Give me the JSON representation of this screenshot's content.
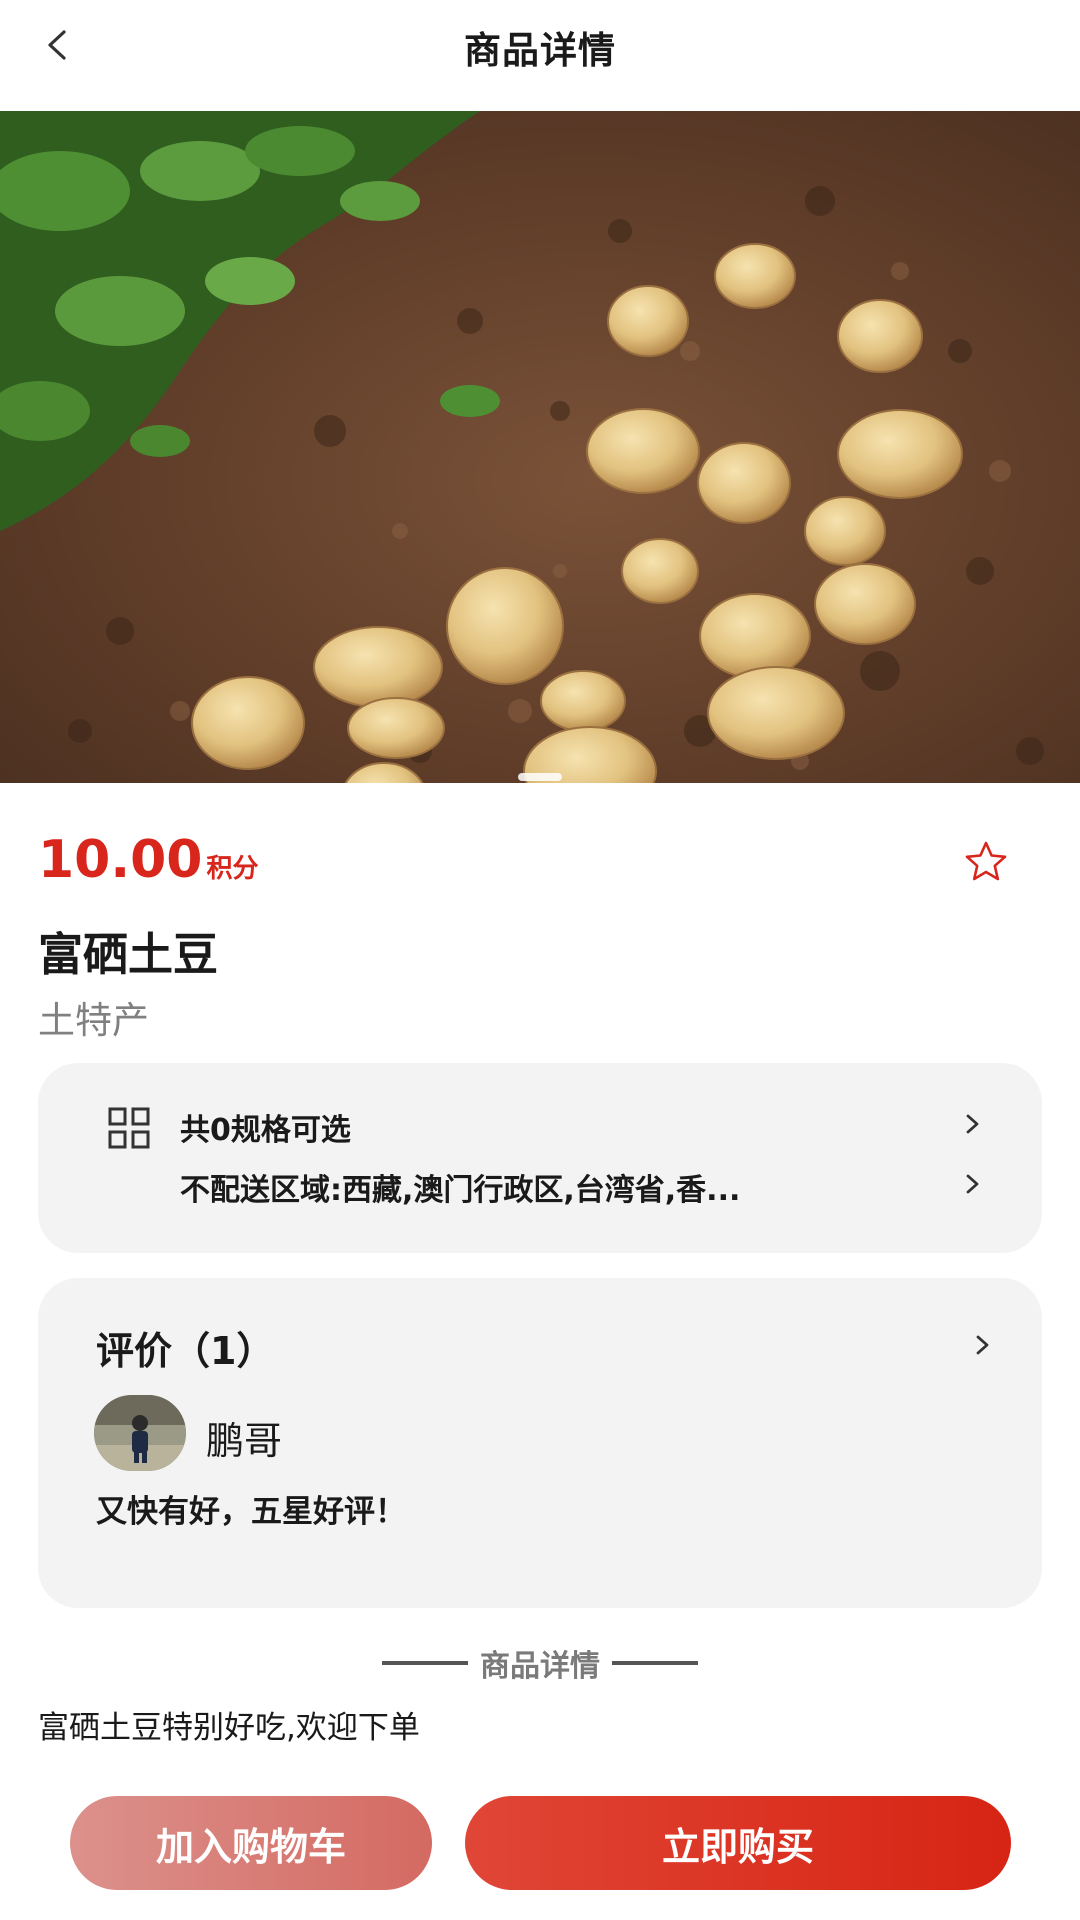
{
  "header": {
    "title": "商品详情",
    "back_icon": "chevron-left-icon"
  },
  "product": {
    "price": "10.00",
    "price_unit": "积分",
    "name": "富硒土豆",
    "category": "土特产",
    "favorite_icon": "star-outline-icon",
    "image_indicator": {
      "current": 1,
      "total": 1
    }
  },
  "specs": {
    "options_text": "共0规格可选",
    "no_delivery_text": "不配送区域:西藏,澳门行政区,台湾省,香..."
  },
  "reviews": {
    "title": "评价（1）",
    "reviewer_name": "鹏哥",
    "review_text": "又快有好，五星好评！"
  },
  "detail": {
    "section_title": "商品详情",
    "description": "富硒土豆特别好吃,欢迎下单"
  },
  "actions": {
    "add_to_cart_label": "加入购物车",
    "buy_now_label": "立即购买"
  },
  "colors": {
    "accent": "#d9261c",
    "card_bg": "#f3f3f3",
    "cart_button": "#d8807a",
    "buy_button": "#dc3323"
  }
}
